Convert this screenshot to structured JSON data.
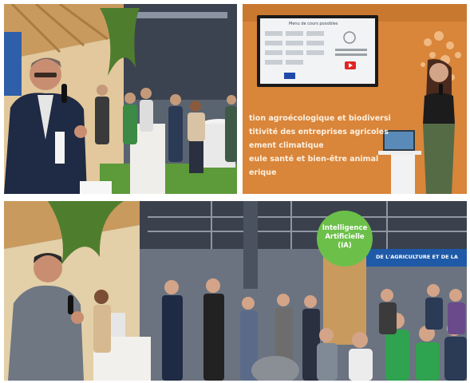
{
  "panel2": {
    "screen_title": "Menu de cours possibles",
    "wall_lines": [
      "tion agroécologique et biodiversi",
      "titivité des entreprises agricoles",
      "ement climatique",
      "eule santé et bien-être animal",
      "erique"
    ]
  },
  "panel3": {
    "sign_lines": [
      "Intelligence",
      "Artificielle",
      "(IA)"
    ],
    "banner_text": "DE L'AGRICULTURE ET DE LA"
  },
  "colors": {
    "wood": "#c99a5d",
    "orange_wall": "#d9853a",
    "ia_sign": "#6cc04a",
    "green_shirt": "#2fa34f",
    "grass": "#5d9a3a"
  }
}
